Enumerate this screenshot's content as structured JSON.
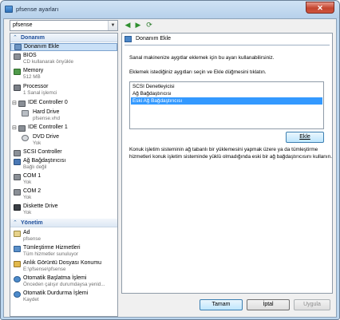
{
  "window": {
    "title": "pfsense ayarları",
    "close_label": "✕"
  },
  "vm_selector": {
    "value": "pfsense"
  },
  "sections": {
    "hardware": "Donanım",
    "management": "Yönetim"
  },
  "hardware_items": [
    {
      "label": "Donanım Ekle",
      "sub": ""
    },
    {
      "label": "BIOS",
      "sub": "CD kullanarak önyükle"
    },
    {
      "label": "Memory",
      "sub": "512 MB"
    },
    {
      "label": "Processor",
      "sub": "1 Sanal işlemci"
    },
    {
      "label": "IDE Controller 0",
      "sub": ""
    },
    {
      "label": "Hard Drive",
      "sub": "pfsense.vhd"
    },
    {
      "label": "IDE Controller 1",
      "sub": ""
    },
    {
      "label": "DVD Drive",
      "sub": "Yok"
    },
    {
      "label": "SCSI Controller",
      "sub": ""
    },
    {
      "label": "Ağ Bağdaştırıcısı",
      "sub": "Bağlı değil"
    },
    {
      "label": "COM 1",
      "sub": "Yok"
    },
    {
      "label": "COM 2",
      "sub": "Yok"
    },
    {
      "label": "Diskette Drive",
      "sub": "Yok"
    }
  ],
  "management_items": [
    {
      "label": "Ad",
      "sub": "pfsense"
    },
    {
      "label": "Tümleştirme Hizmetleri",
      "sub": "Tüm hizmetler sunuluyor"
    },
    {
      "label": "Anlık Görüntü Dosyası Konumu",
      "sub": "E:\\pfsense\\pfsense"
    },
    {
      "label": "Otomatik Başlatma İşlemi",
      "sub": "Önceden çalışır durumdaysa yenid..."
    },
    {
      "label": "Otomatik Durdurma İşlemi",
      "sub": "Kaydet"
    }
  ],
  "panel": {
    "title": "Donanım Ekle",
    "intro": "Sanal makinenize aygıtlar eklemek için bu ayarı kullanabilirsiniz.",
    "instruction": "Eklemek istediğiniz aygıtları seçin ve Ekle düğmesini tıklatın.",
    "devices": [
      "SCSI Denetleyicisi",
      "Ağ Bağdaştırıcısı",
      "Eski Ağ Bağdaştırıcısı"
    ],
    "selected_device_index": 2,
    "add_button": "Ekle",
    "desc_line1": "Konuk işletim sisteminin ağ tabanlı bir yüklemesini yapmak üzere ya da tümleştirme",
    "desc_line2": "hizmetleri konuk işletim sisteminde yüklü olmadığında eski bir ağ bağdaştırıcısını kullanın."
  },
  "buttons": {
    "ok": "Tamam",
    "cancel": "İptal",
    "apply": "Uygula"
  }
}
